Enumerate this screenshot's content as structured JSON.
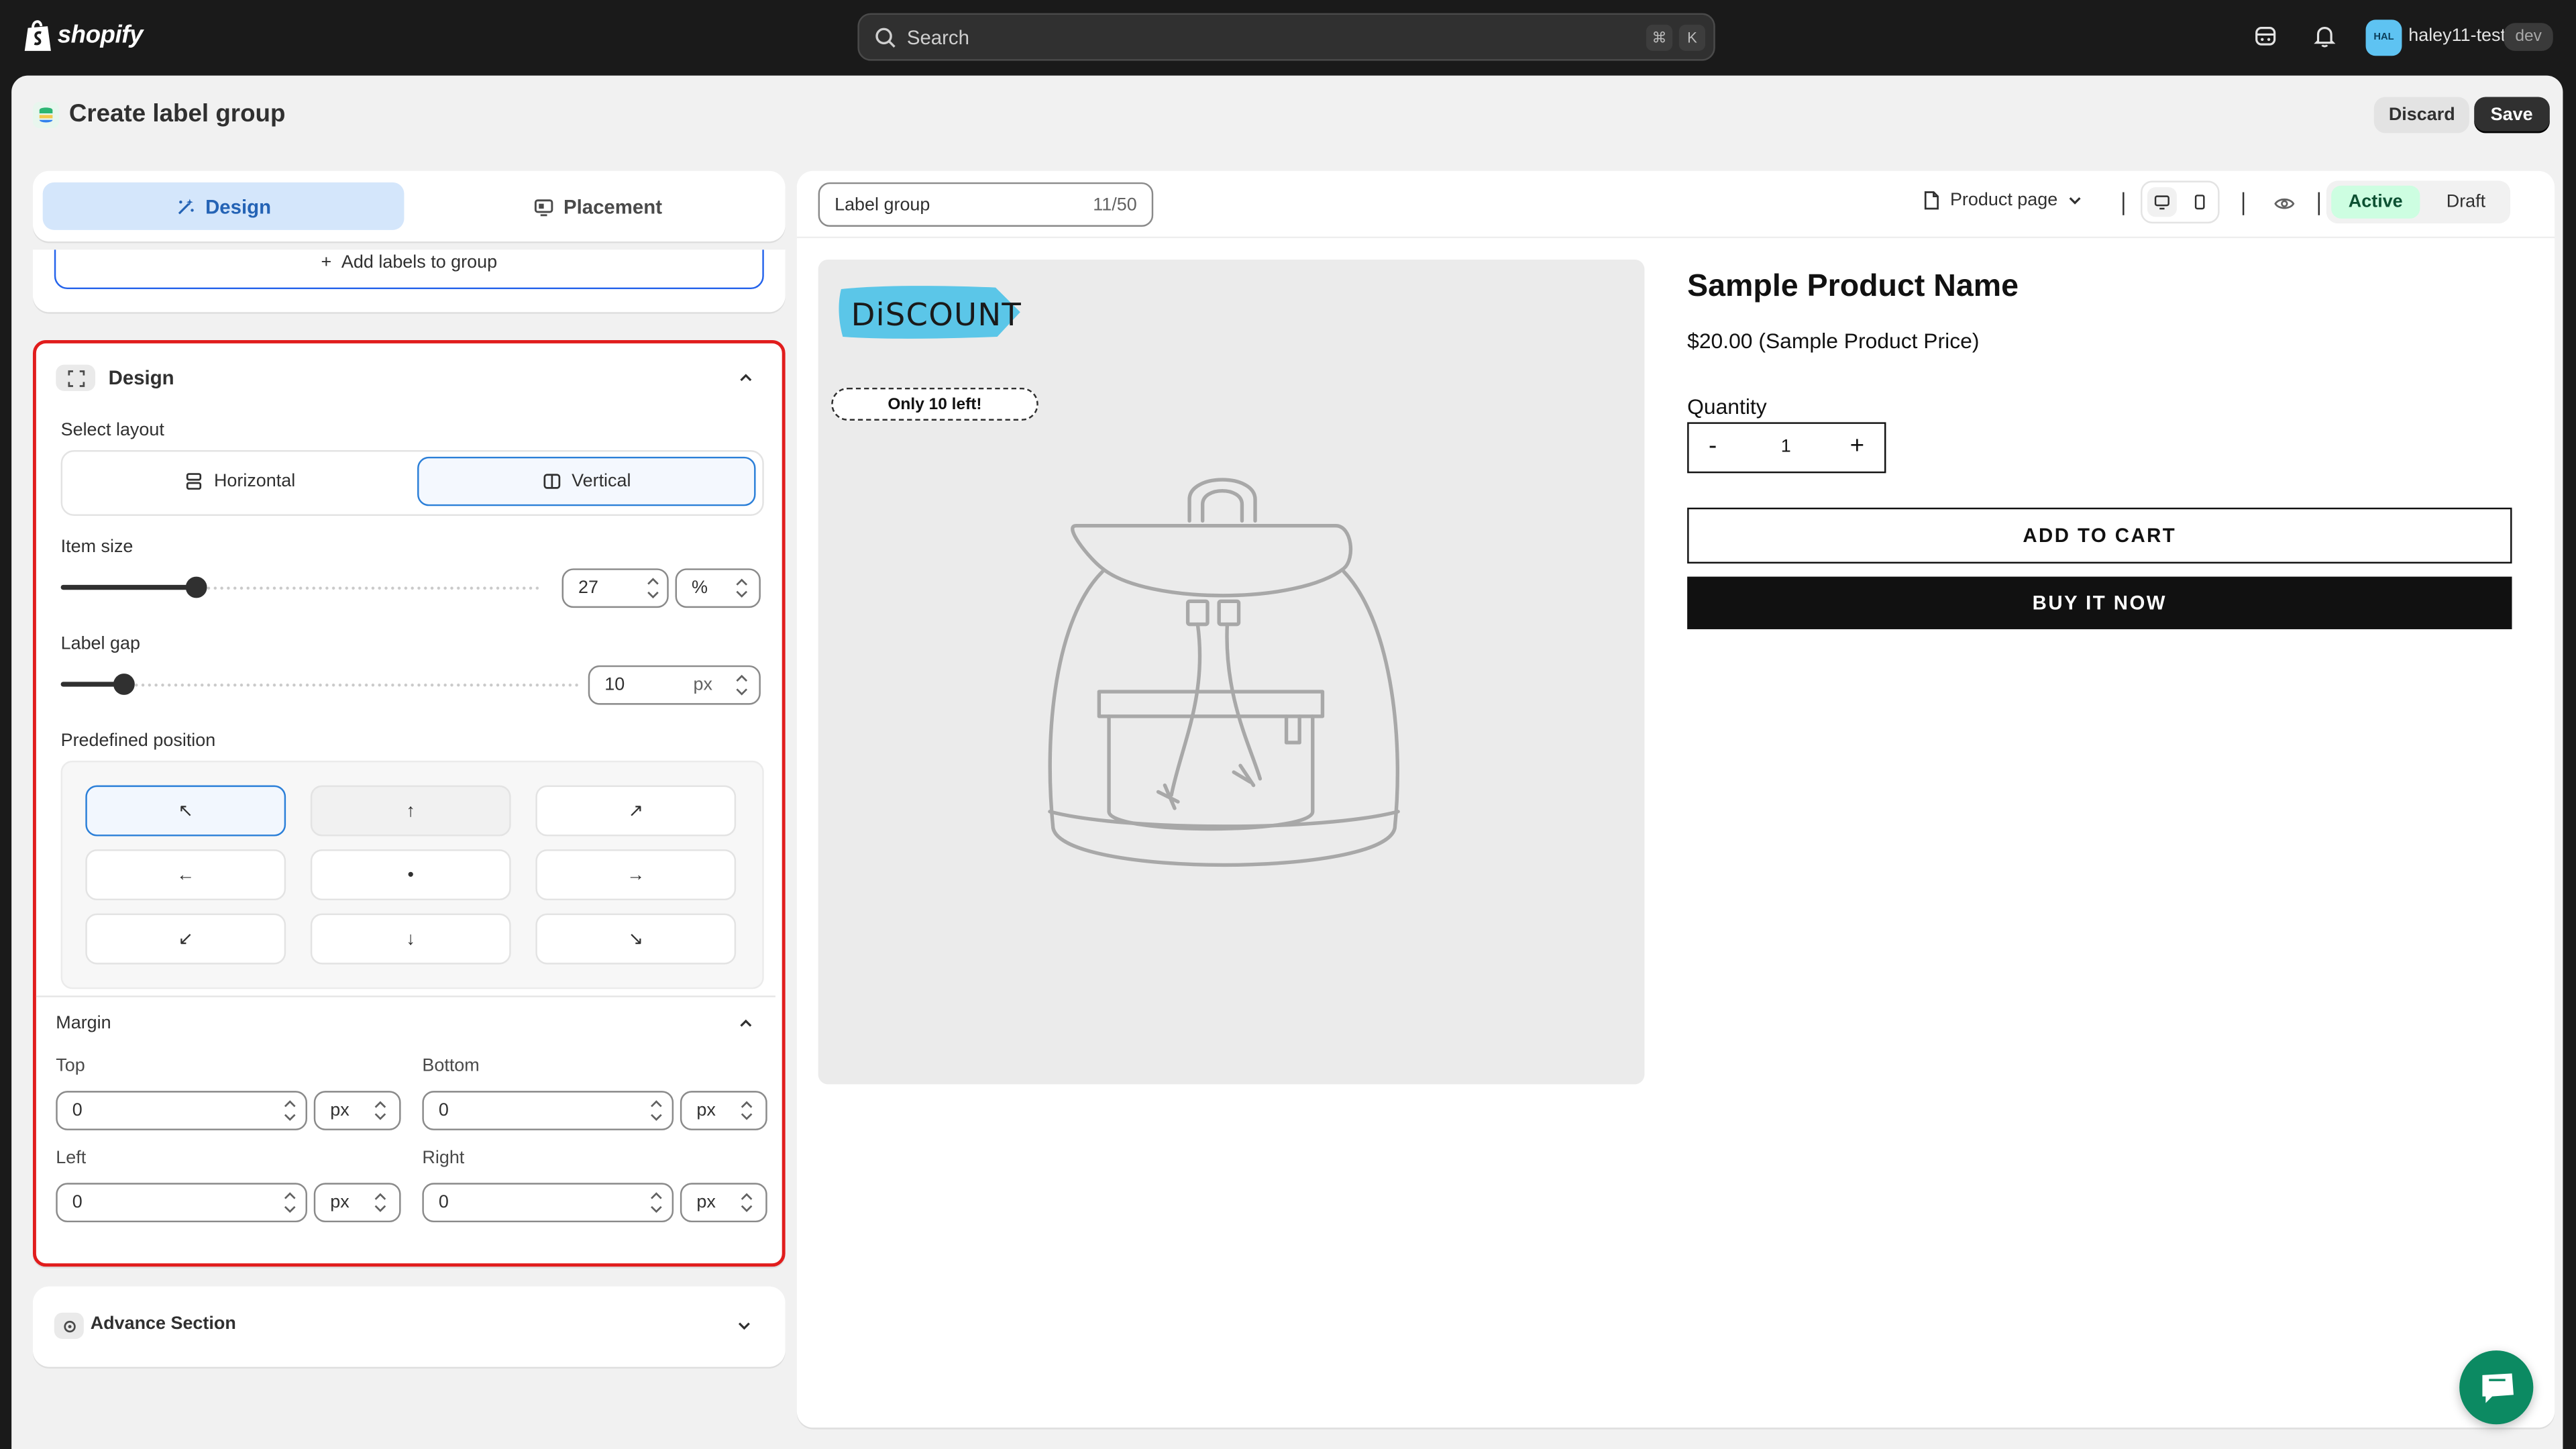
{
  "topbar": {
    "logo_text": "shopify",
    "search_placeholder": "Search",
    "shortcut_cmd": "⌘",
    "shortcut_key": "K",
    "avatar_initials": "HAL",
    "store_name": "haley11-test",
    "store_badge": "dev",
    "icons": [
      "shopify-bag-icon",
      "search-icon",
      "sidekick-icon",
      "bell-icon"
    ]
  },
  "page": {
    "title": "Create label group",
    "discard_label": "Discard",
    "save_label": "Save"
  },
  "tabs": {
    "design_label": "Design",
    "placement_label": "Placement",
    "active": "Design"
  },
  "add_labels_label": "Add labels to group",
  "design_section": {
    "title": "Design",
    "select_layout_label": "Select layout",
    "layout_options": {
      "horizontal": "Horizontal",
      "vertical": "Vertical"
    },
    "selected_layout": "Vertical",
    "item_size": {
      "label": "Item size",
      "value": "27",
      "unit": "%",
      "slider_fraction": 0.27
    },
    "label_gap": {
      "label": "Label gap",
      "value": "10",
      "unit": "px",
      "slider_fraction": 0.12
    },
    "predefined_position": {
      "label": "Predefined position",
      "arrows": [
        "↖",
        "↑",
        "↗",
        "←",
        "•",
        "→",
        "↙",
        "↓",
        "↘"
      ],
      "selected": "top-left"
    },
    "margin": {
      "title": "Margin",
      "top": {
        "label": "Top",
        "value": "0",
        "unit": "px"
      },
      "bottom": {
        "label": "Bottom",
        "value": "0",
        "unit": "px"
      },
      "left": {
        "label": "Left",
        "value": "0",
        "unit": "px"
      },
      "right": {
        "label": "Right",
        "value": "0",
        "unit": "px"
      }
    }
  },
  "advance_section": {
    "title": "Advance Section"
  },
  "preview": {
    "name_placeholder": "Label group",
    "name_counter": "11/50",
    "page_select": "Product page",
    "status_active": "Active",
    "status_draft": "Draft",
    "discount_label": "DiSCOUNT",
    "stock_label": "Only 10 left!",
    "product_name": "Sample Product Name",
    "product_price": "$20.00 (Sample Product Price)",
    "quantity_label": "Quantity",
    "qty_minus": "-",
    "qty_value": "1",
    "qty_plus": "+",
    "add_to_cart": "ADD TO CART",
    "buy_now": "BUY IT NOW"
  },
  "colors": {
    "accent_blue": "#2b7fd8",
    "tab_active_bg": "#d4e6fb",
    "highlight_red": "#e11d1d",
    "active_green_bg": "#cdfee1",
    "discount_tag_blue": "#5bc6e8",
    "chat_green": "#0c8a62"
  }
}
